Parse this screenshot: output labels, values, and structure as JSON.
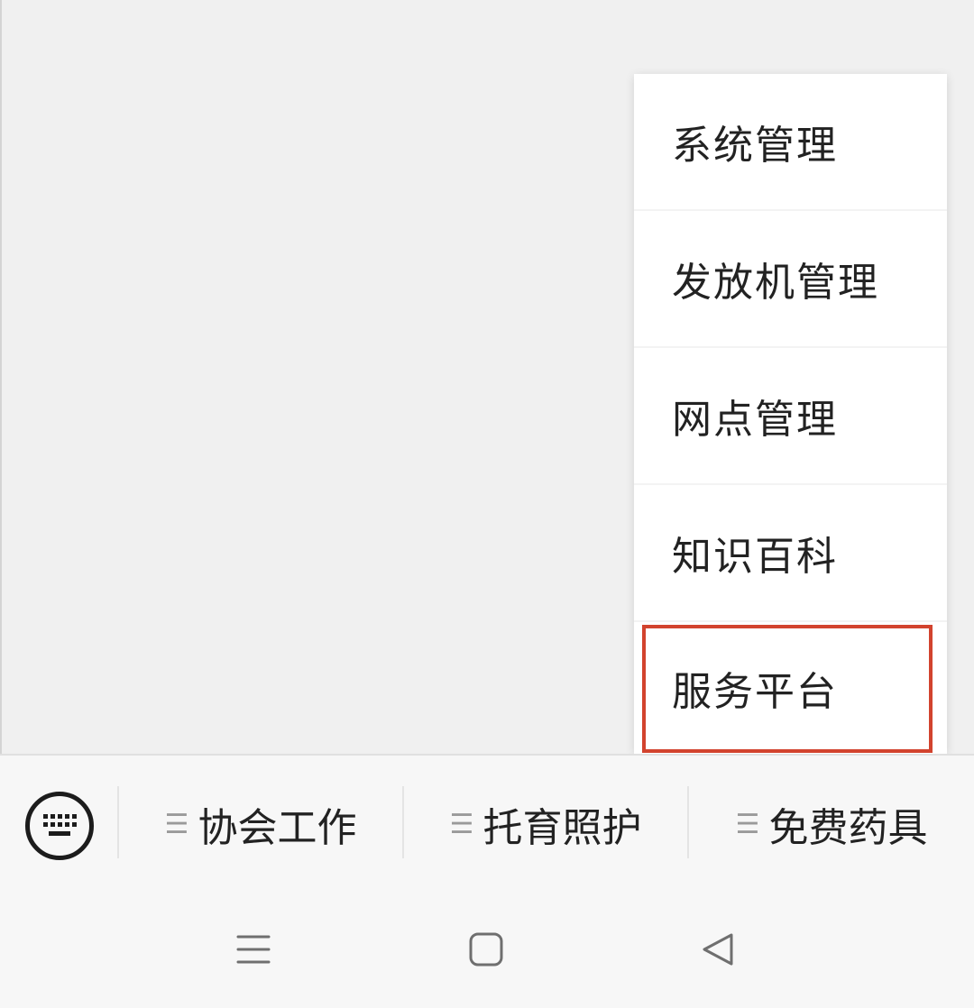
{
  "popup_menu": {
    "items": [
      {
        "label": "系统管理"
      },
      {
        "label": "发放机管理"
      },
      {
        "label": "网点管理"
      },
      {
        "label": "知识百科"
      },
      {
        "label": "服务平台"
      }
    ],
    "highlight_color": "#d2432e"
  },
  "bottom_menu": {
    "keyboard_icon": "keyboard-icon",
    "items": [
      {
        "icon": "menu-lines-icon",
        "label": "协会工作"
      },
      {
        "icon": "menu-lines-icon",
        "label": "托育照护"
      },
      {
        "icon": "menu-lines-icon",
        "label": "免费药具"
      }
    ]
  },
  "system_nav": {
    "buttons": [
      "recent-apps-icon",
      "home-icon",
      "back-icon"
    ]
  }
}
